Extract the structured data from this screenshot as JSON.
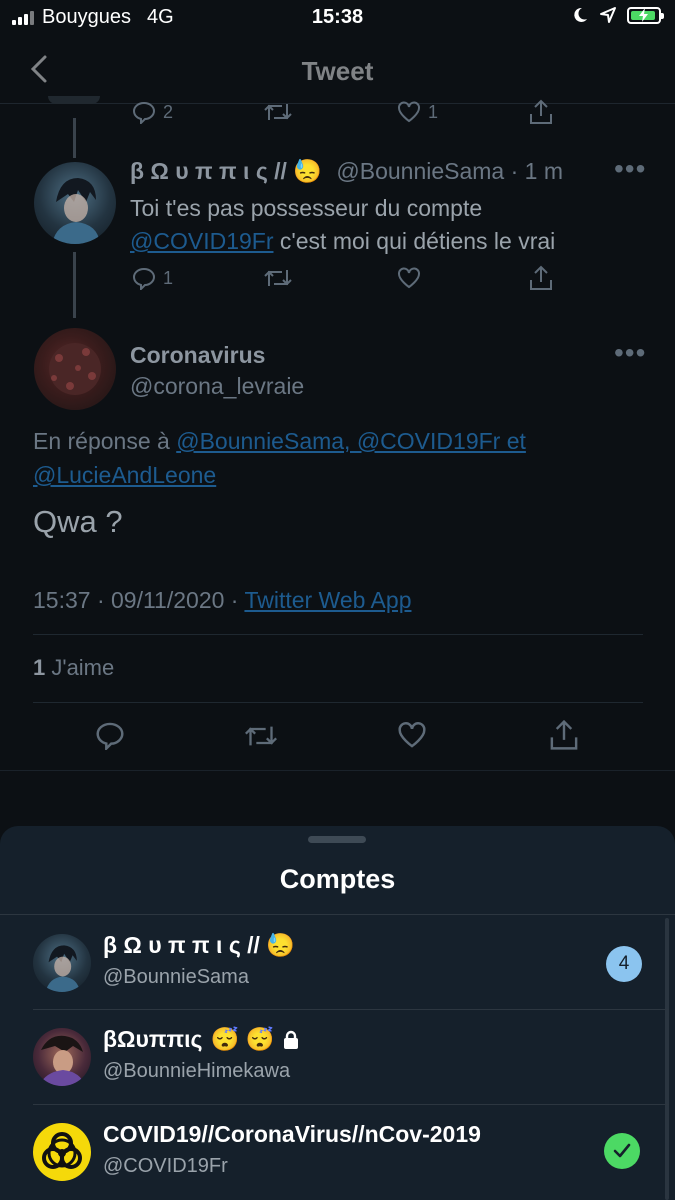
{
  "status": {
    "carrier": "Bouygues",
    "network": "4G",
    "time": "15:38"
  },
  "nav": {
    "title": "Tweet"
  },
  "top_tweet": {
    "replies": "2",
    "likes": "1"
  },
  "reply_tweet": {
    "name": "β Ω υ π π ι ς //",
    "emoji": "😓",
    "handle": "@BounnieSama",
    "time": "· 1 m",
    "text_line1": "Toi t'es pas possesseur du compte",
    "text_mention": "@COVID19Fr",
    "text_line2_rest": " c'est moi qui détiens le vrai",
    "replies": "1"
  },
  "main_tweet": {
    "name": "Coronavirus",
    "handle": "@corona_levraie",
    "reply_prefix": "En réponse à ",
    "reply_mentions_1": "@BounnieSama, @COVID19Fr et",
    "reply_mentions_2": "@LucieAndLeone",
    "text": "Qwa ?",
    "timestamp": "15:37 · 09/11/2020 · ",
    "source": "Twitter Web App",
    "likes_count": "1",
    "likes_label": " J'aime"
  },
  "sheet": {
    "title": "Comptes",
    "accounts": [
      {
        "name": "β Ω υ π π ι ς //",
        "emoji": "😓",
        "handle": "@BounnieSama",
        "badge": "4"
      },
      {
        "name": "βΩυππις",
        "emoji": "😴 😴",
        "handle": "@BounnieHimekawa"
      },
      {
        "name": "COVID19//CoronaVirus//nCov-2019",
        "handle": "@COVID19Fr"
      }
    ]
  },
  "colors": {
    "accent": "#1da1f2",
    "check": "#4cd964",
    "badge": "#8bc4ef"
  }
}
